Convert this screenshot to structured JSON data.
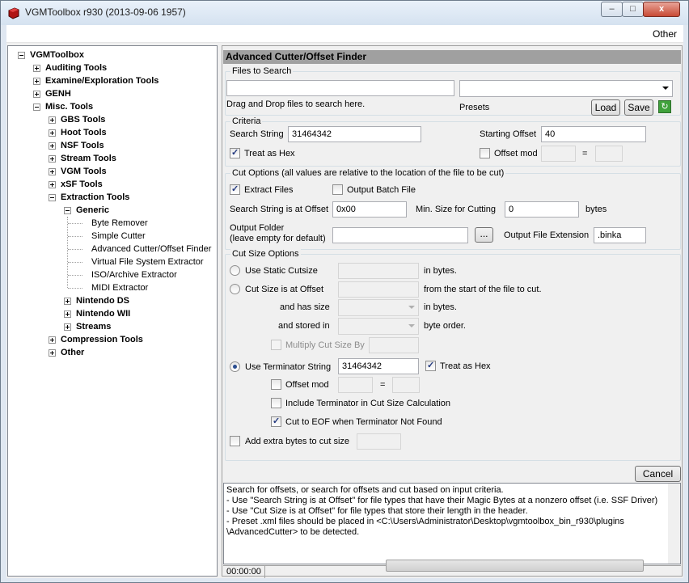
{
  "window": {
    "title": "VGMToolbox r930 (2013-09-06 1957)",
    "min_label": "–",
    "max_label": "□",
    "close_label": "x"
  },
  "menu": {
    "other": "Other"
  },
  "tree": [
    {
      "label": "VGMToolbox",
      "bold": true
    },
    {
      "label": "Auditing Tools",
      "bold": true
    },
    {
      "label": "Examine/Exploration Tools",
      "bold": true
    },
    {
      "label": "GENH",
      "bold": true
    },
    {
      "label": "Misc. Tools",
      "bold": true
    },
    {
      "label": "GBS Tools",
      "bold": true
    },
    {
      "label": "Hoot Tools",
      "bold": true
    },
    {
      "label": "NSF Tools",
      "bold": true
    },
    {
      "label": "Stream Tools",
      "bold": true
    },
    {
      "label": "VGM Tools",
      "bold": true
    },
    {
      "label": "xSF Tools",
      "bold": true
    },
    {
      "label": "Extraction Tools",
      "bold": true
    },
    {
      "label": "Generic",
      "bold": true
    },
    {
      "label": "Byte Remover",
      "bold": false
    },
    {
      "label": "Simple Cutter",
      "bold": false
    },
    {
      "label": "Advanced Cutter/Offset Finder",
      "bold": false
    },
    {
      "label": "Virtual File System Extractor",
      "bold": false
    },
    {
      "label": "ISO/Archive Extractor",
      "bold": false
    },
    {
      "label": "MIDI Extractor",
      "bold": false
    },
    {
      "label": "Nintendo DS",
      "bold": true
    },
    {
      "label": "Nintendo WII",
      "bold": true
    },
    {
      "label": "Streams",
      "bold": true
    },
    {
      "label": "Compression Tools",
      "bold": true
    },
    {
      "label": "Other",
      "bold": true
    }
  ],
  "panel": {
    "header": "Advanced Cutter/Offset Finder",
    "files": {
      "group_title": "Files to Search",
      "path_value": "",
      "preset_value": "",
      "drag_hint": "Drag and Drop files to search here.",
      "presets_label": "Presets",
      "load_button": "Load",
      "save_button": "Save"
    },
    "criteria": {
      "group_title": "Criteria",
      "search_string_label": "Search String",
      "search_string_value": "31464342",
      "starting_offset_label": "Starting Offset",
      "starting_offset_value": "40",
      "treat_as_hex_label": "Treat as Hex",
      "treat_as_hex_checked": true,
      "offset_mod_label": "Offset mod",
      "offset_mod_checked": false,
      "equals": "="
    },
    "cut_options": {
      "group_title": "Cut Options (all values are relative to the location of the file to be cut)",
      "extract_files_label": "Extract Files",
      "extract_files_checked": true,
      "output_batch_label": "Output Batch File",
      "output_batch_checked": false,
      "search_at_offset_label": "Search String is at Offset",
      "search_at_offset_value": "0x00",
      "min_size_label": "Min. Size for Cutting",
      "min_size_value": "0",
      "bytes_label": "bytes",
      "output_folder_label_1": "Output Folder",
      "output_folder_label_2": "(leave empty for default)",
      "output_folder_value": "",
      "browse_button": "...",
      "output_ext_label": "Output File Extension",
      "output_ext_value": ".binka"
    },
    "cut_size": {
      "group_title": "Cut Size Options",
      "static_label": "Use Static Cutsize",
      "in_bytes_1": "in bytes.",
      "cut_at_offset_label": "Cut Size is at Offset",
      "from_start_label": "from the start of the file to cut.",
      "and_has_size_label": "and has size",
      "in_bytes_2": "in bytes.",
      "and_stored_in_label": "and stored in",
      "byte_order_label": "byte order.",
      "multiply_label": "Multiply Cut Size By",
      "terminator_label": "Use Terminator String",
      "terminator_value": "31464342",
      "term_hex_label": "Treat as Hex",
      "term_hex_checked": true,
      "term_offset_mod_label": "Offset mod",
      "equals": "=",
      "include_term_label": "Include Terminator in Cut Size Calculation",
      "include_term_checked": false,
      "cut_to_eof_label": "Cut to EOF when Terminator Not Found",
      "cut_to_eof_checked": true,
      "extra_bytes_label": "Add extra bytes to cut size",
      "extra_bytes_checked": false,
      "selected_mode": "terminator"
    },
    "cancel_button": "Cancel",
    "description": [
      "Search for offsets, or search for offsets and cut based on input criteria.",
      "- Use \"Search String is at Offset\" for file types that have their Magic Bytes at a nonzero offset (i.e. SSF Driver)",
      "- Use \"Cut Size is at Offset\" for file types that store their length in the header.",
      "- Preset .xml files should be placed in <C:\\Users\\Administrator\\Desktop\\vgmtoolbox_bin_r930\\plugins",
      "\\AdvancedCutter> to be detected."
    ],
    "status_time": "00:00:00"
  }
}
